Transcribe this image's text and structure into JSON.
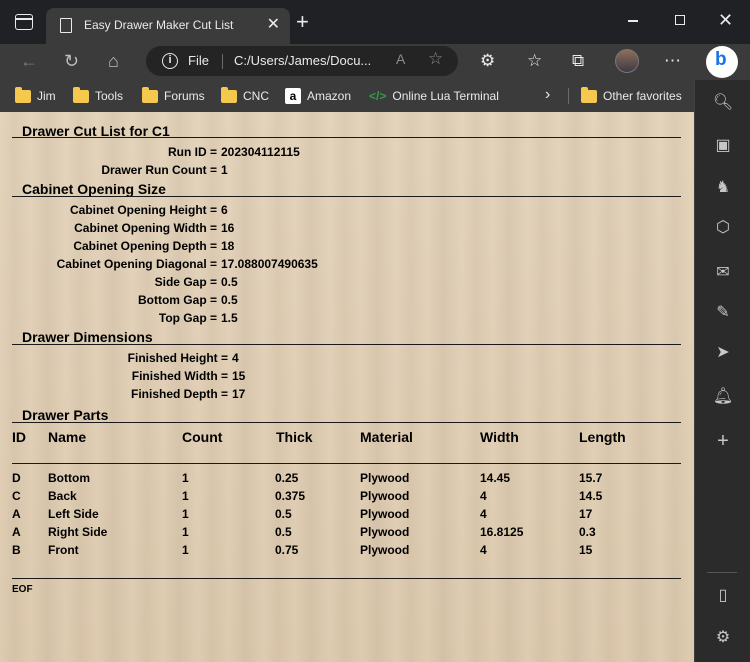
{
  "browser": {
    "tab_title": "Easy Drawer Maker Cut List",
    "address_scheme": "File",
    "address_text": "C:/Users/James/Docu...",
    "favorites": [
      "Jim",
      "Tools",
      "Forums",
      "CNC",
      "Amazon",
      "Online Lua Terminal"
    ],
    "other_favorites": "Other favorites"
  },
  "report": {
    "title": "Drawer Cut List for C1",
    "run_id": {
      "label": "Run ID =",
      "value": "202304112115"
    },
    "run_count": {
      "label": "Drawer Run Count =",
      "value": "1"
    },
    "cabinet_section": "Cabinet Opening Size",
    "cabinet_fields": [
      {
        "label": "Cabinet Opening Height =",
        "value": "6"
      },
      {
        "label": "Cabinet Opening Width =",
        "value": "16"
      },
      {
        "label": "Cabinet Opening Depth =",
        "value": "18"
      },
      {
        "label": "Cabinet Opening Diagonal =",
        "value": "17.088007490635"
      },
      {
        "label": "Side Gap =",
        "value": "0.5"
      },
      {
        "label": "Bottom Gap =",
        "value": "0.5"
      },
      {
        "label": "Top Gap =",
        "value": "1.5"
      }
    ],
    "drawer_section": "Drawer Dimensions",
    "drawer_fields": [
      {
        "label": "Finished Height =",
        "value": "4"
      },
      {
        "label": "Finished Width =",
        "value": "15"
      },
      {
        "label": "Finished Depth =",
        "value": "17"
      }
    ],
    "parts_section": "Drawer Parts",
    "parts_headers": [
      "ID",
      "Name",
      "Count",
      "Thick",
      "Material",
      "Width",
      "Length"
    ],
    "parts_rows": [
      [
        "D",
        "Bottom",
        "1",
        "0.25",
        "Plywood",
        "14.45",
        "15.7"
      ],
      [
        "C",
        "Back",
        "1",
        "0.375",
        "Plywood",
        "4",
        "14.5"
      ],
      [
        "A",
        "Left Side",
        "1",
        "0.5",
        "Plywood",
        "4",
        "17"
      ],
      [
        "A",
        "Right Side",
        "1",
        "0.5",
        "Plywood",
        "16.8125",
        "0.3"
      ],
      [
        "B",
        "Front",
        "1",
        "0.75",
        "Plywood",
        "4",
        "15"
      ]
    ],
    "eof": "EOF"
  }
}
